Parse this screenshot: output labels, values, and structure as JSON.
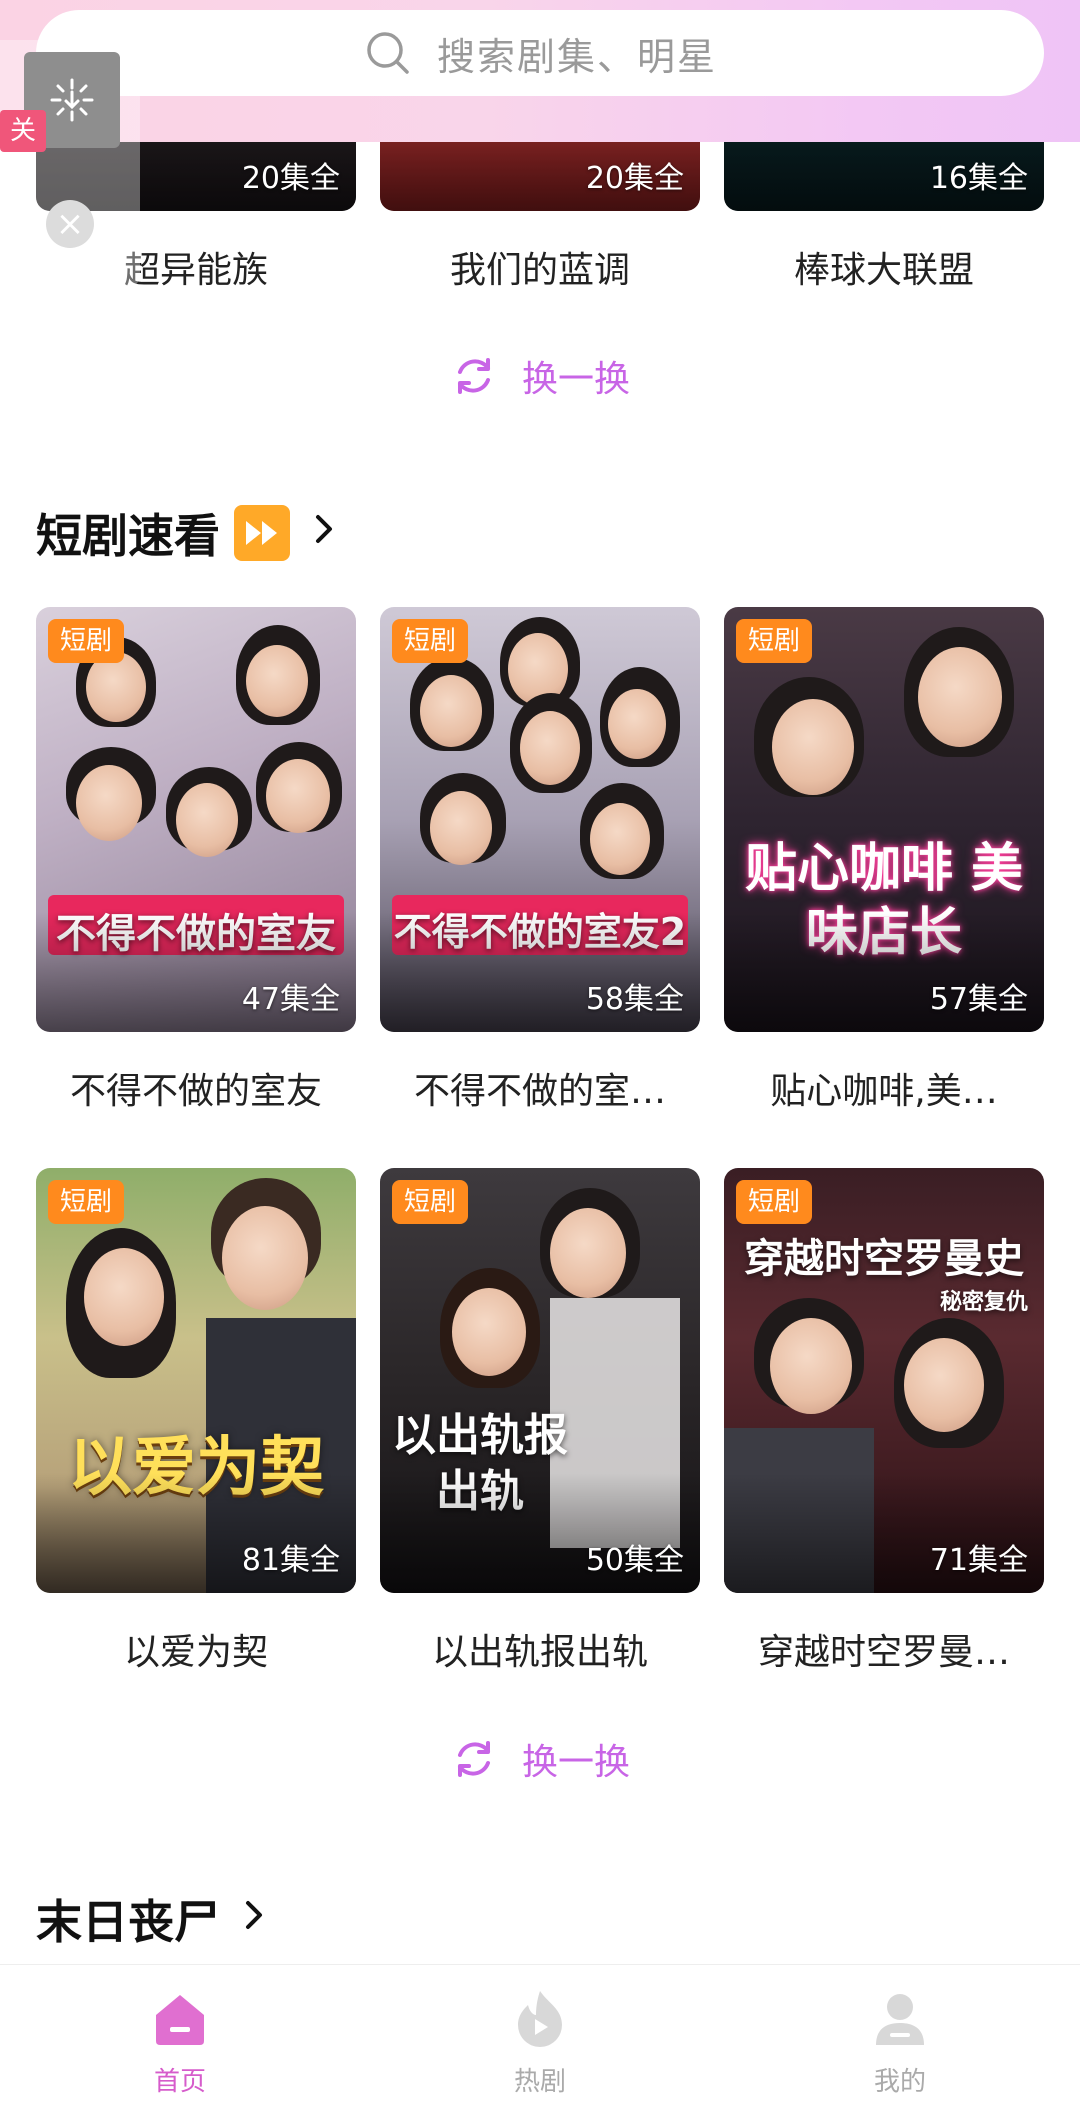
{
  "search": {
    "placeholder": "搜索剧集、明星"
  },
  "float_widget": {
    "badge": "关"
  },
  "top_row": [
    {
      "title": "超异能族",
      "count": "20集全"
    },
    {
      "title": "我们的蓝调",
      "count": "20集全"
    },
    {
      "title": "棒球大联盟",
      "count": "16集全"
    }
  ],
  "refresh_label": "换一换",
  "short_drama": {
    "title": "短剧速看",
    "cards": [
      {
        "title": "不得不做的室友",
        "count": "47集全",
        "tag": "短剧",
        "overlay": "不得不做的室友"
      },
      {
        "title": "不得不做的室…",
        "count": "58集全",
        "tag": "短剧",
        "overlay": "不得不做的室友2"
      },
      {
        "title": "贴心咖啡,美…",
        "count": "57集全",
        "tag": "短剧",
        "overlay": "贴心咖啡 美味店长"
      },
      {
        "title": "以爱为契",
        "count": "81集全",
        "tag": "短剧",
        "overlay": "以爱为契"
      },
      {
        "title": "以出轨报出轨",
        "count": "50集全",
        "tag": "短剧",
        "overlay": "以出轨报 出轨"
      },
      {
        "title": "穿越时空罗曼…",
        "count": "71集全",
        "tag": "短剧",
        "overlay": "穿越时空罗曼史",
        "overlay_sub": "秘密复仇"
      }
    ]
  },
  "zombie_section": {
    "title": "末日丧尸"
  },
  "nav": {
    "items": [
      {
        "label": "首页"
      },
      {
        "label": "热剧"
      },
      {
        "label": "我的"
      }
    ]
  },
  "colors": {
    "accent": "#d65ccb",
    "refresh": "#c865e6",
    "tag": "#ff8a1d",
    "title_band": "#e8285d"
  }
}
